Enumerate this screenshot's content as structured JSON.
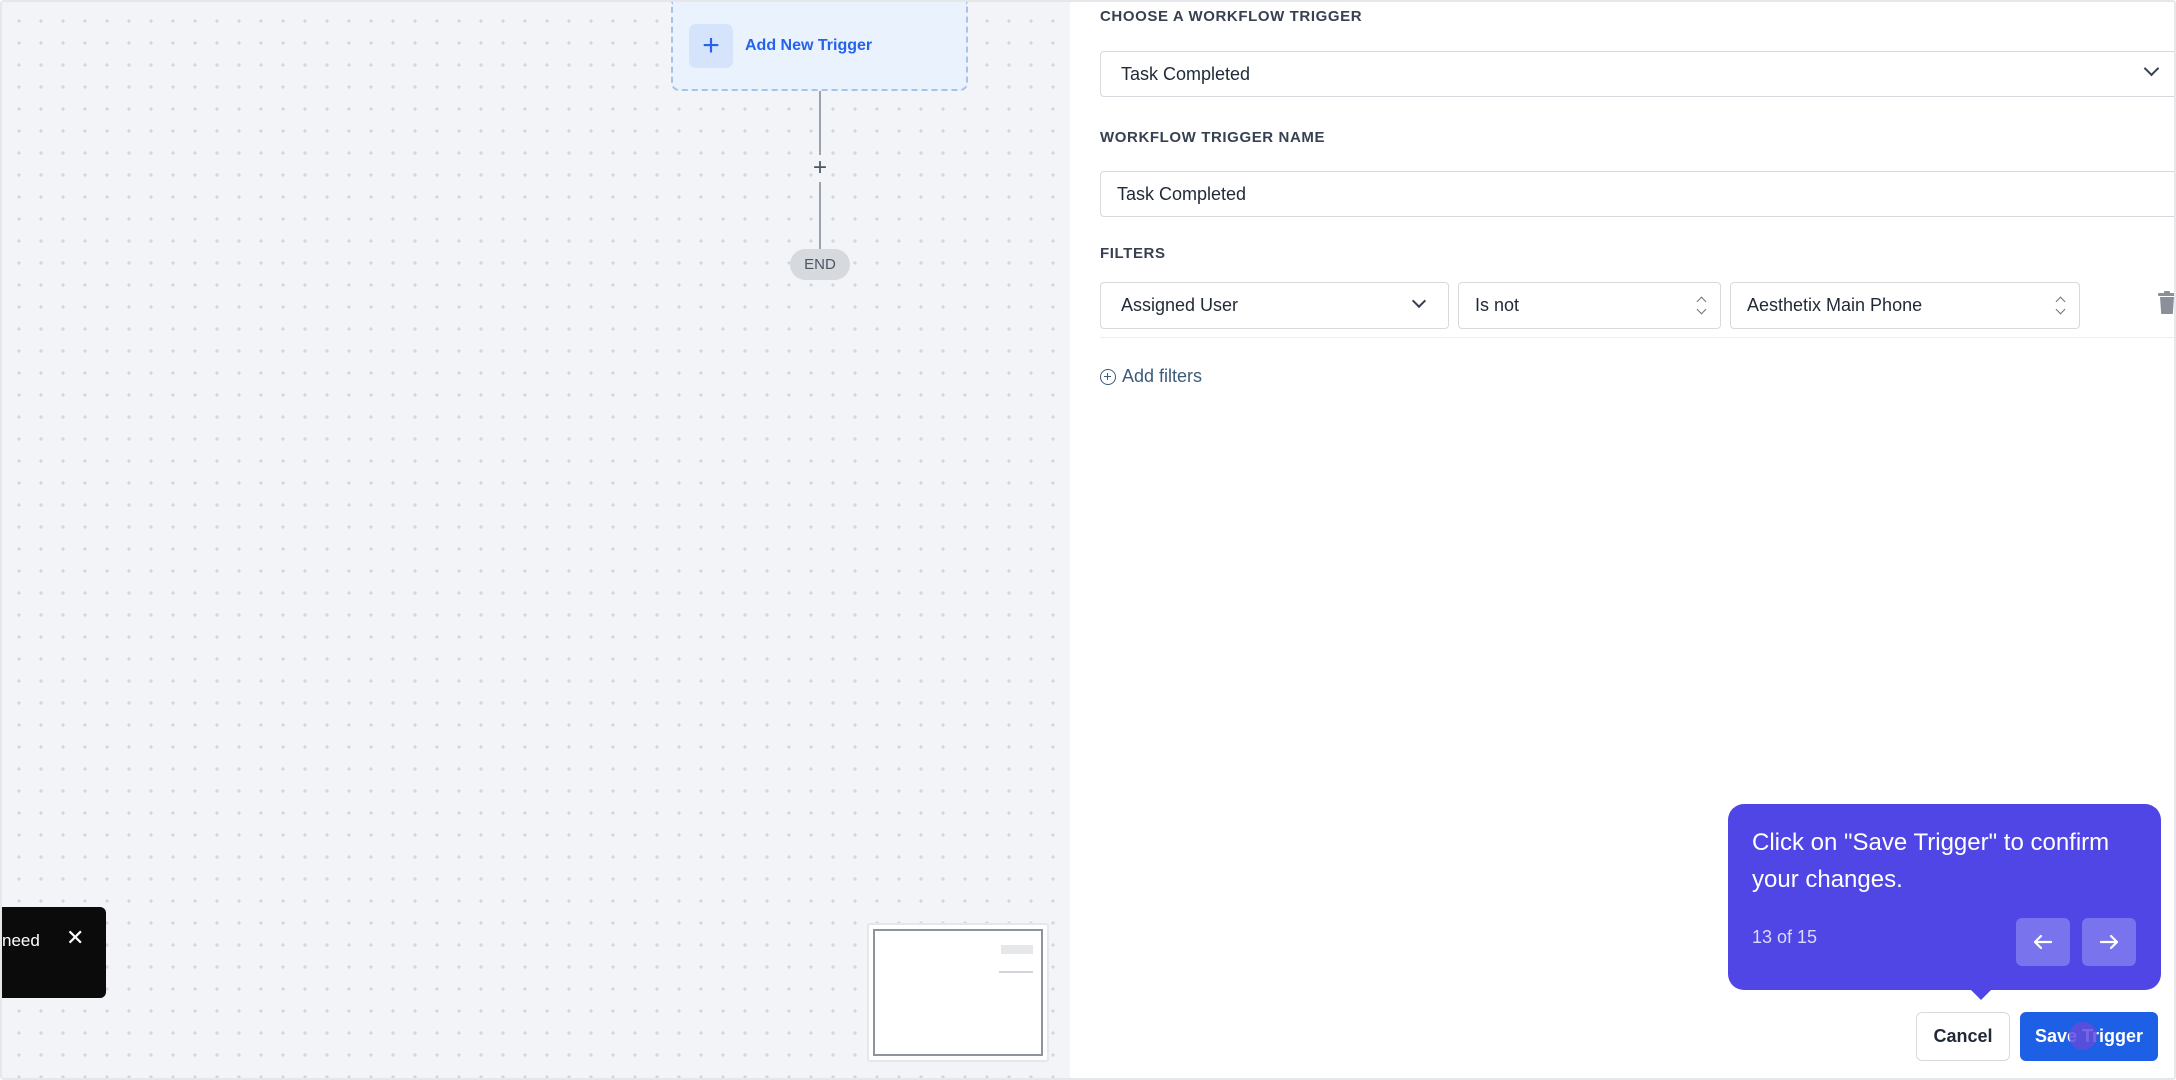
{
  "canvas": {
    "trigger_node_label": "Add New Trigger",
    "add_step_symbol": "+",
    "end_label": "END",
    "toast_text": "need",
    "toast_close_symbol": "✕"
  },
  "panel": {
    "trigger_section_label": "CHOOSE A WORKFLOW TRIGGER",
    "trigger_selected": "Task Completed",
    "name_section_label": "WORKFLOW TRIGGER NAME",
    "name_value": "Task Completed",
    "filters_section_label": "FILTERS",
    "filters": [
      {
        "field": "Assigned User",
        "operator": "Is not",
        "value": "Aesthetix Main Phone"
      }
    ],
    "add_filters_label": "Add filters"
  },
  "guide": {
    "text": "Click on \"Save Trigger\" to confirm your changes.",
    "step": "13 of 15"
  },
  "footer": {
    "cancel_label": "Cancel",
    "save_label": "Save Trigger"
  },
  "colors": {
    "primary": "#1d5fe5",
    "guide_bg": "#4f46e5",
    "canvas_bg": "#f3f4f8"
  }
}
